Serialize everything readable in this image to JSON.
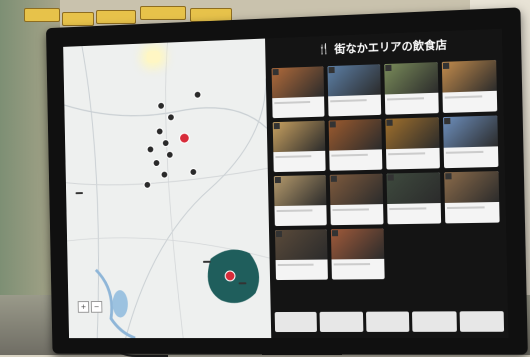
{
  "kiosk": {
    "list_title": "街なかエリアの飲食店",
    "fork_icon": "fork-knife-icon"
  },
  "map": {
    "pills": [
      "",
      "",
      ""
    ]
  },
  "cards": [
    {
      "name": "",
      "color": "#b06a3a"
    },
    {
      "name": "",
      "color": "#5c7fa6"
    },
    {
      "name": "",
      "color": "#7a8c5a"
    },
    {
      "name": "",
      "color": "#c28b4c"
    },
    {
      "name": "",
      "color": "#c7a060"
    },
    {
      "name": "",
      "color": "#9b5a2e"
    },
    {
      "name": "",
      "color": "#a0702c"
    },
    {
      "name": "",
      "color": "#6d8fbd"
    },
    {
      "name": "",
      "color": "#b59a6c"
    },
    {
      "name": "",
      "color": "#7e5a3d"
    },
    {
      "name": "",
      "color": "#3e4a3e"
    },
    {
      "name": "",
      "color": "#8b6b4a"
    },
    {
      "name": "",
      "color": "#5a4a3a"
    },
    {
      "name": "",
      "color": "#a05a3a"
    }
  ],
  "bottom_buttons": [
    "",
    "",
    "",
    "",
    ""
  ]
}
